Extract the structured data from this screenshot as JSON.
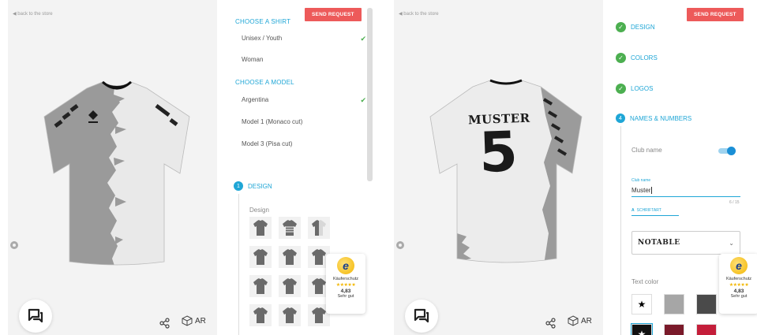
{
  "common": {
    "back_link": "◀ back to the store",
    "send_request": "SEND REQUEST",
    "ar_label": "AR"
  },
  "left": {
    "sections": [
      {
        "title": "CHOOSE A SHIRT",
        "options": [
          {
            "label": "Unisex / Youth",
            "selected": true
          },
          {
            "label": "Woman",
            "selected": false
          }
        ]
      },
      {
        "title": "CHOOSE A MODEL",
        "options": [
          {
            "label": "Argentina",
            "selected": true
          },
          {
            "label": "Model 1 (Monaco cut)",
            "selected": false
          },
          {
            "label": "Model 3 (Pisa cut)",
            "selected": false
          }
        ]
      }
    ],
    "step": {
      "number": "1",
      "title": "DESIGN"
    },
    "design_label": "Design",
    "thumbnail_count": 12
  },
  "right": {
    "steps": [
      {
        "title": "DESIGN",
        "done": true
      },
      {
        "title": "COLORS",
        "done": true
      },
      {
        "title": "LOGOS",
        "done": true
      },
      {
        "number": "4",
        "title": "NAMES & NUMBERS",
        "done": false
      }
    ],
    "club_name_toggle": {
      "label": "Club name",
      "on": true
    },
    "club_name_field": {
      "label": "Club name",
      "value": "Muster",
      "counter": "6 / 15"
    },
    "font_link": "SCHRIFTART",
    "font_select": "NOTABLE",
    "text_color_label": "Text color",
    "swatch_colors": [
      "#ffffff",
      "#a6a6a6",
      "#4a4a4a",
      "#111111",
      "#7a1a2a",
      "#c41e3a"
    ],
    "jersey": {
      "name": "MUSTER",
      "number": "5"
    }
  },
  "badge": {
    "label": "Käuferschutz",
    "stars": "★★★★★",
    "score": "4,83",
    "grade": "Sehr gut"
  }
}
